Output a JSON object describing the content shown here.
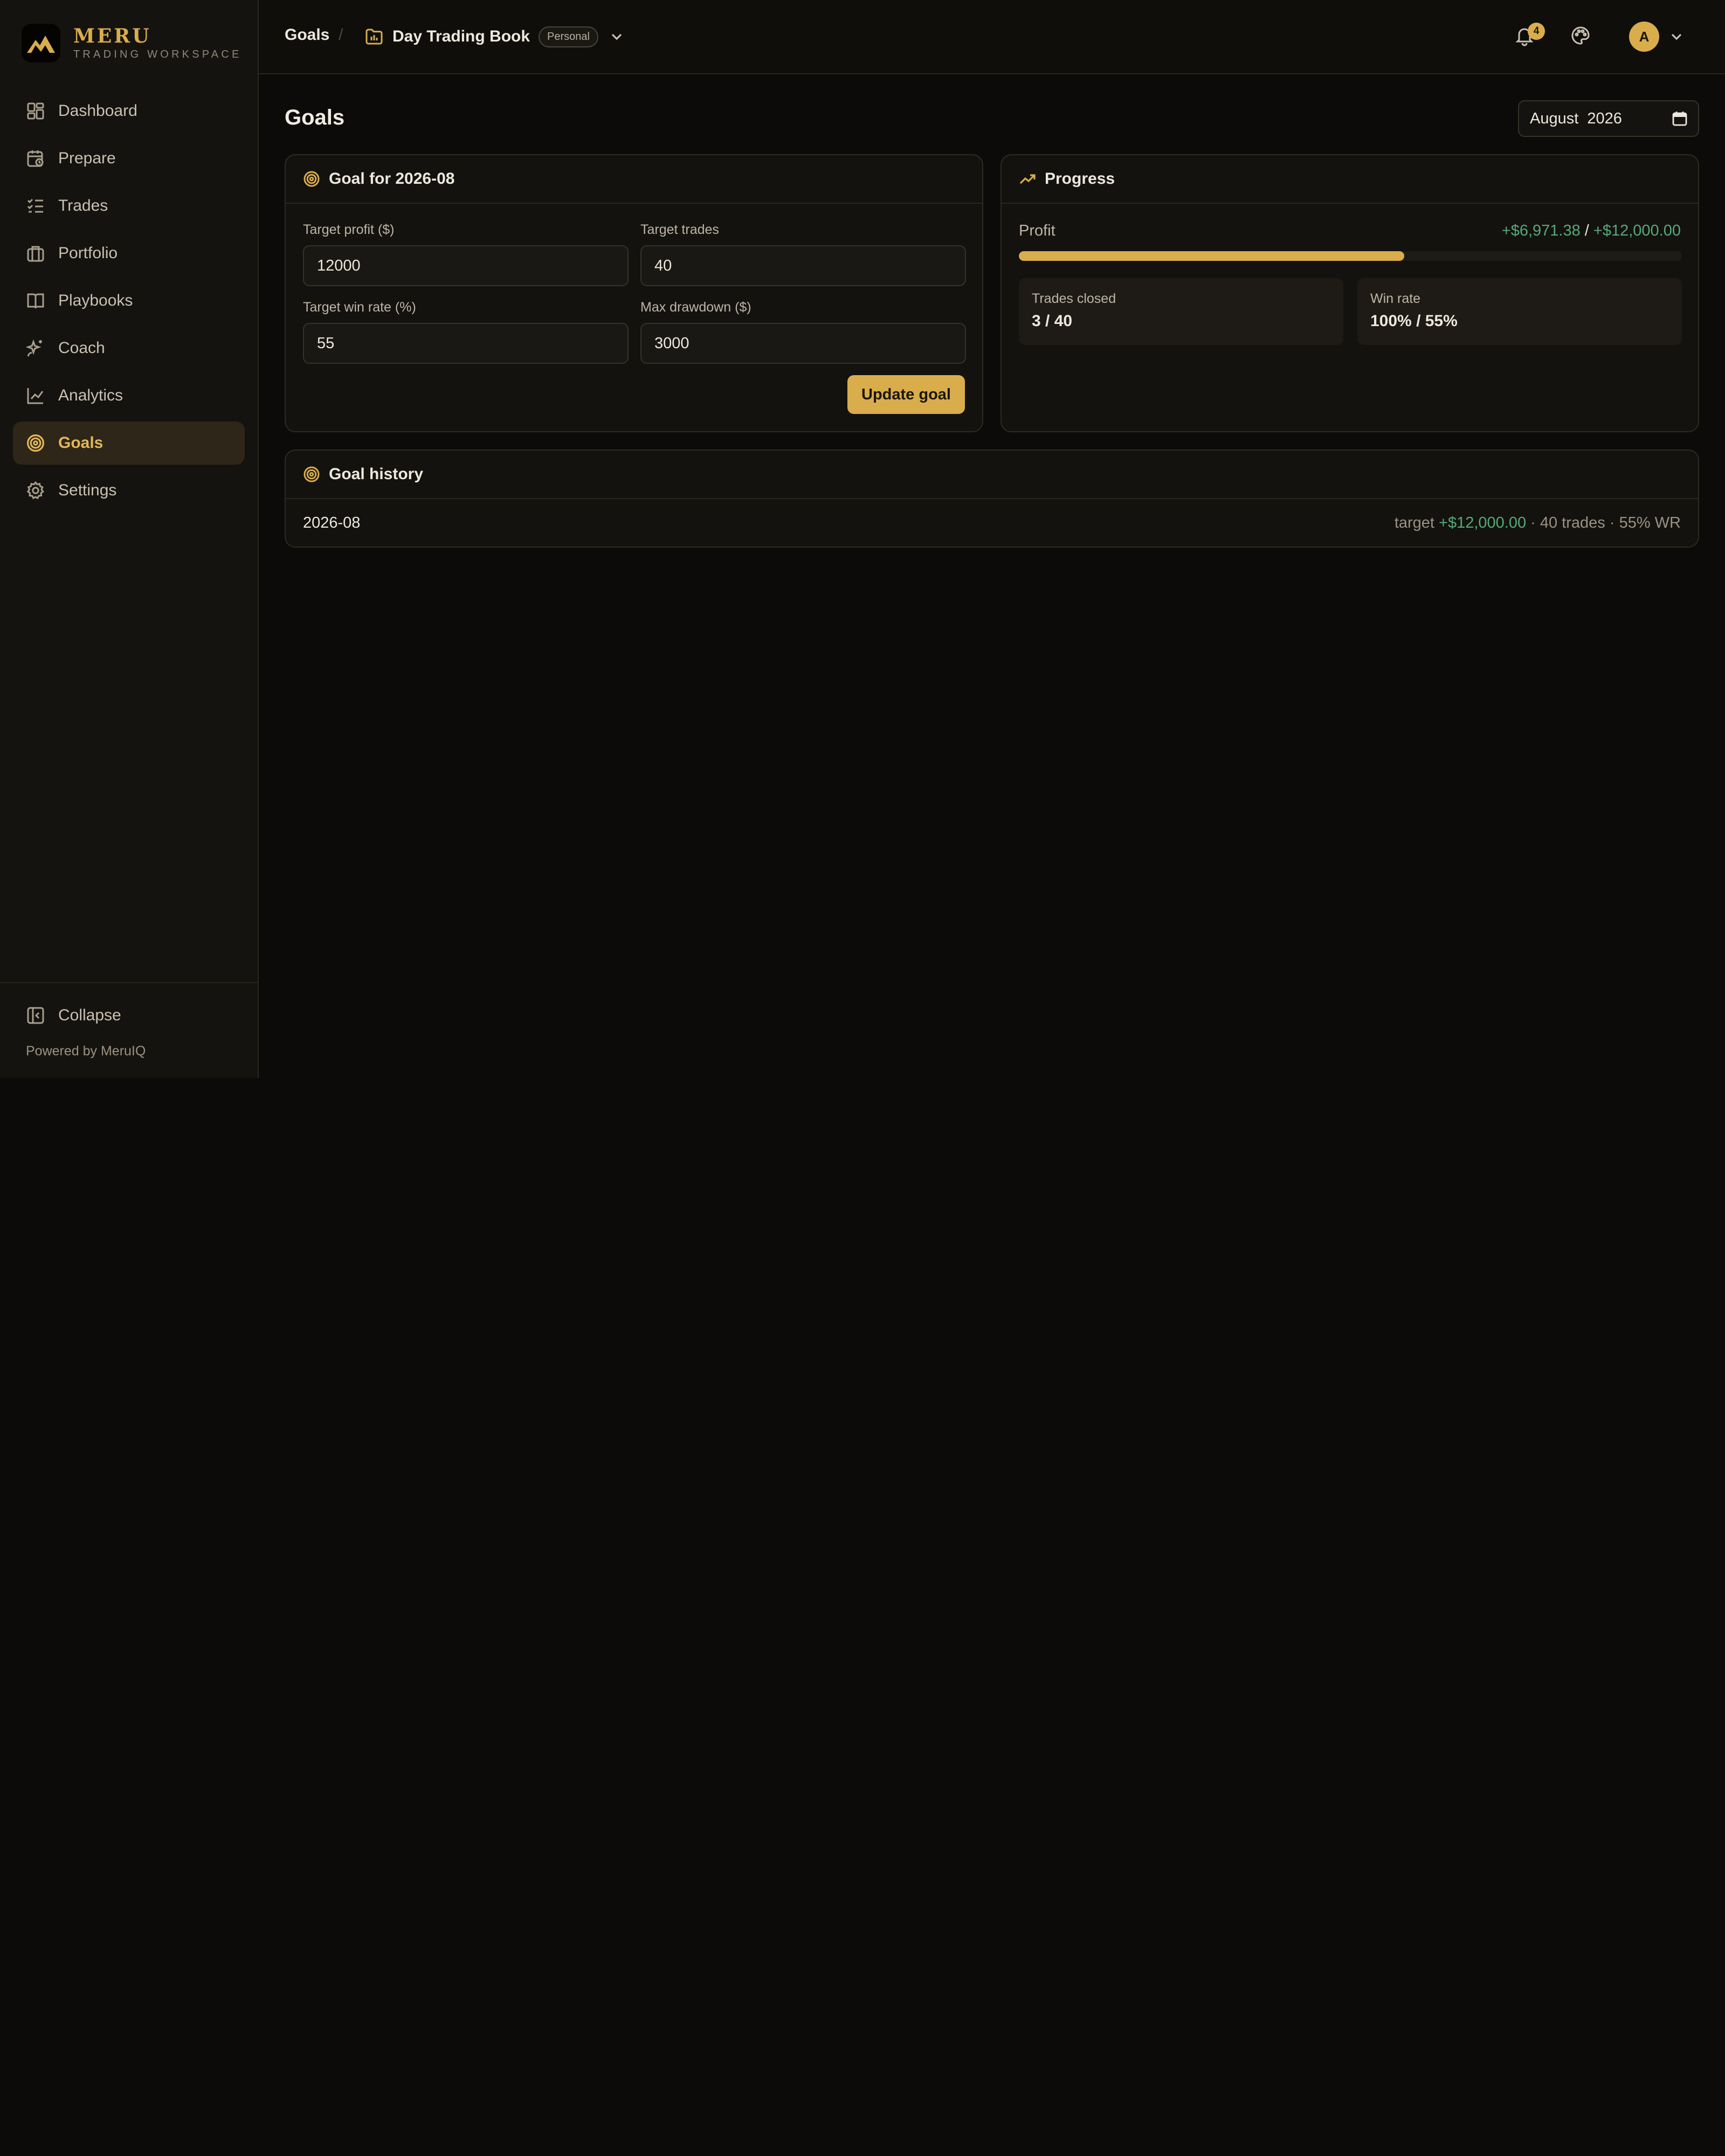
{
  "brand": {
    "name": "MERU",
    "subtitle": "TRADING WORKSPACE"
  },
  "sidebar": {
    "items": [
      {
        "label": "Dashboard",
        "icon": "dashboard-icon"
      },
      {
        "label": "Prepare",
        "icon": "calendar-clock-icon"
      },
      {
        "label": "Trades",
        "icon": "checklist-icon"
      },
      {
        "label": "Portfolio",
        "icon": "briefcase-icon"
      },
      {
        "label": "Playbooks",
        "icon": "book-open-icon"
      },
      {
        "label": "Coach",
        "icon": "sparkles-icon"
      },
      {
        "label": "Analytics",
        "icon": "line-chart-icon"
      },
      {
        "label": "Goals",
        "icon": "target-icon",
        "active": true
      },
      {
        "label": "Settings",
        "icon": "gear-icon"
      }
    ],
    "collapse_label": "Collapse",
    "powered_by": "Powered by MeruIQ"
  },
  "header": {
    "breadcrumb": "Goals",
    "separator": "/",
    "book_name": "Day Trading Book",
    "book_badge": "Personal",
    "notification_count": "4",
    "avatar_initial": "A"
  },
  "main": {
    "title": "Goals",
    "month": "August  2026"
  },
  "goal_form": {
    "title": "Goal for 2026-08",
    "fields": [
      {
        "label": "Target profit ($)",
        "value": "12000"
      },
      {
        "label": "Target trades",
        "value": "40"
      },
      {
        "label": "Target win rate (%)",
        "value": "55"
      },
      {
        "label": "Max drawdown ($)",
        "value": "3000"
      }
    ],
    "submit_label": "Update goal"
  },
  "progress": {
    "title": "Progress",
    "profit_label": "Profit",
    "profit_current": "+$6,971.38",
    "profit_separator": " / ",
    "profit_target": "+$12,000.00",
    "profit_fraction": 0.581,
    "trades_label": "Trades closed",
    "trades_value": "3 / 40",
    "winrate_label": "Win rate",
    "winrate_value": "100% / 55%"
  },
  "history": {
    "title": "Goal history",
    "rows": [
      {
        "month": "2026-08",
        "prefix": "target ",
        "amount": "+$12,000.00",
        "suffix": " · 40 trades · 55% WR"
      }
    ]
  },
  "colors": {
    "accent": "#d9ad4c",
    "positive": "#56a97a",
    "background": "#0c0b09",
    "sidebar": "#15130f"
  }
}
